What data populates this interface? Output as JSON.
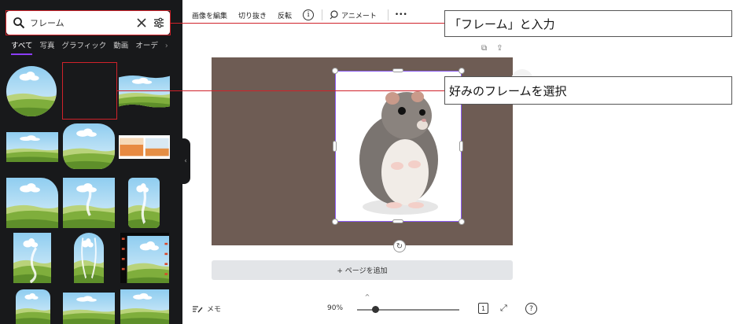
{
  "left_panel": {
    "search": {
      "value": "フレーム",
      "placeholder": "フレーム"
    },
    "tabs": [
      {
        "label": "すべて",
        "active": true
      },
      {
        "label": "写真"
      },
      {
        "label": "グラフィック"
      },
      {
        "label": "動画"
      },
      {
        "label": "オーデ"
      }
    ],
    "tabs_more": "›",
    "collapse_glyph": "‹"
  },
  "toolbar": {
    "edit_image": "画像を編集",
    "crop": "切り抜き",
    "flip": "反転",
    "info": "i",
    "animate": "アニメート",
    "more": "•••"
  },
  "page_actions": {
    "duplicate": "⧉",
    "share": "⇪"
  },
  "canvas": {
    "add_page": "+ ページを追加",
    "background_color": "#6e5c54"
  },
  "bottom_bar": {
    "notes": "メモ",
    "zoom": "90%",
    "zoom_level": 0.18,
    "page_num": "1",
    "fullscreen": "⤢",
    "help": "?",
    "expand": "^"
  },
  "annotations": {
    "callout_1": "「フレーム」と入力",
    "callout_2": "好みのフレームを選択"
  },
  "colors": {
    "panel": "#18191b",
    "accent": "#8b3dff",
    "selection": "#8b5cf6",
    "highlight": "#d0222a",
    "sky": "#bfe2f5",
    "grass": "#7fae3c"
  }
}
